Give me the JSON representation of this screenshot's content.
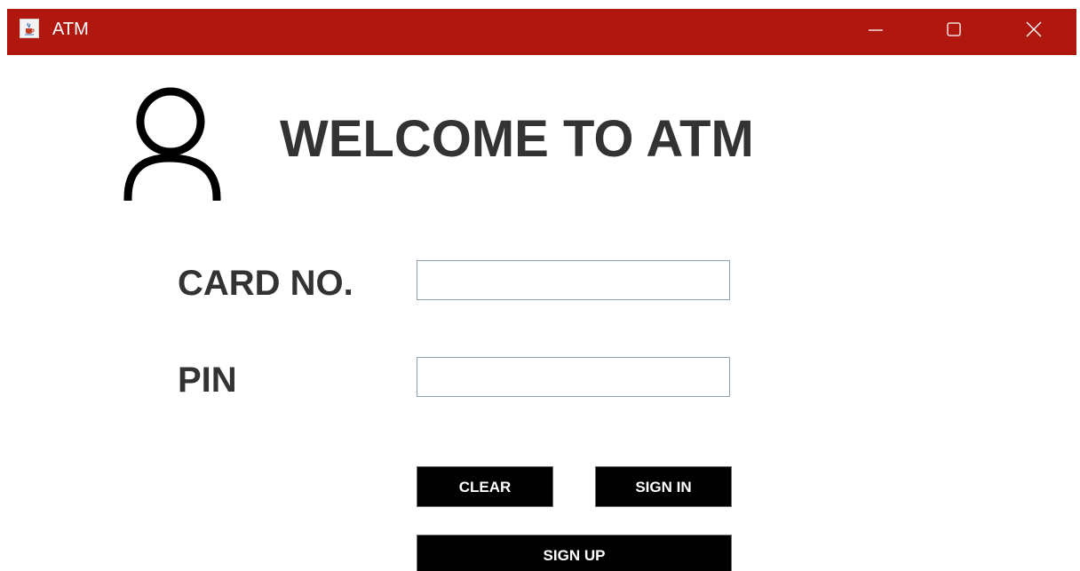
{
  "window": {
    "title": "ATM",
    "titlebar_color": "#b0180f"
  },
  "header": {
    "welcome_text": "WELCOME TO ATM",
    "icon": "user-icon"
  },
  "form": {
    "card_label": "CARD NO.",
    "card_value": "",
    "pin_label": "PIN",
    "pin_value": ""
  },
  "buttons": {
    "clear": "CLEAR",
    "sign_in": "SIGN IN",
    "sign_up": "SIGN UP"
  },
  "icons": {
    "app": "java-cup-icon",
    "minimize": "minimize-icon",
    "maximize": "maximize-icon",
    "close": "close-icon"
  }
}
